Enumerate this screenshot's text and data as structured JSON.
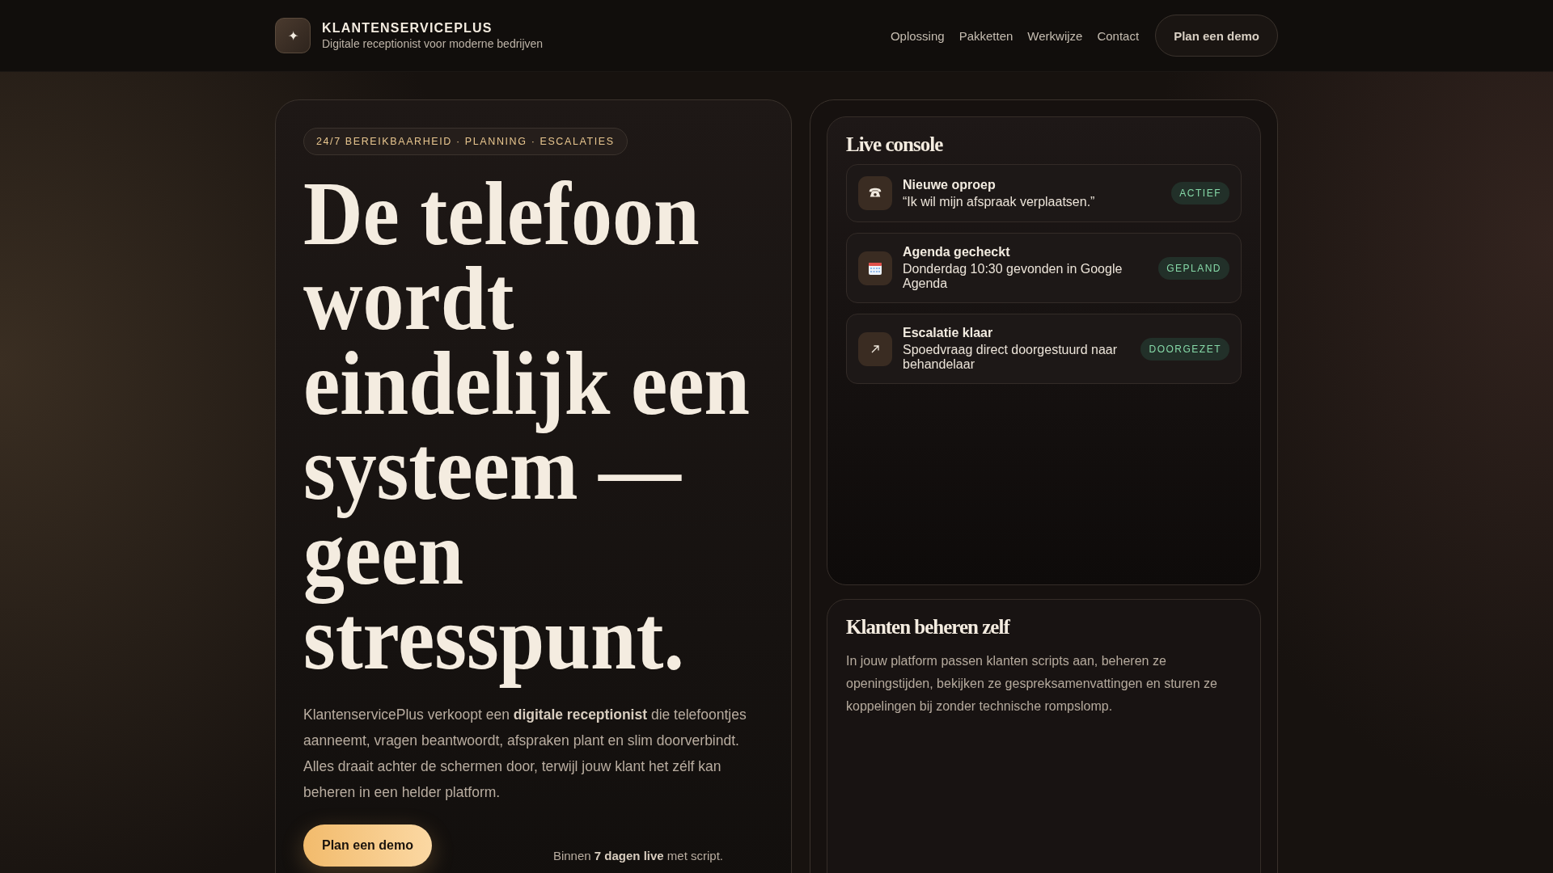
{
  "header": {
    "logo_glyph": "✦",
    "brand": "KLANTENSERVICEPLUS",
    "tagline": "Digitale receptionist voor moderne bedrijven",
    "nav": [
      "Oplossing",
      "Pakketten",
      "Werkwijze",
      "Contact"
    ],
    "cta": "Plan een demo"
  },
  "hero": {
    "tag": "24/7 BEREIKBAARHEID · PLANNING · ESCALATIES",
    "heading": "De telefoon wordt eindelijk een systeem — geen stresspunt.",
    "intro": "KlantenservicePlus verkoopt een **digitale receptionist** die telefoontjes aanneemt, vragen beantwoordt, afspraken plant en slim doorverbindt. Alles draait achter de schermen door, terwijl jouw klant het zélf kan beheren in een helder platform.",
    "button": "Plan een demo",
    "note": "Binnen **7 dagen live** met script."
  },
  "console": {
    "title": "Live console",
    "events": [
      {
        "kind": "phone",
        "title": "Nieuwe oproep",
        "text": "“Ik wil mijn afspraak verplaatsen.”",
        "badge": "ACTIEF"
      },
      {
        "kind": "calendar",
        "title": "Agenda gecheckt",
        "text": "Donderdag 10:30 gevonden in Google Agenda",
        "badge": "GEPLAND"
      },
      {
        "kind": "arrow",
        "title": "Escalatie klaar",
        "text": "Spoedvraag direct doorgestuurd naar behandelaar",
        "badge": "DOORGEZET"
      }
    ]
  },
  "self_service": {
    "title": "Klanten beheren zelf",
    "text": "In jouw platform passen klanten scripts aan, beheren ze openingstijden, bekijken ze gespreksamenvattingen en sturen ze koppelingen bij zonder technische rompslomp."
  }
}
